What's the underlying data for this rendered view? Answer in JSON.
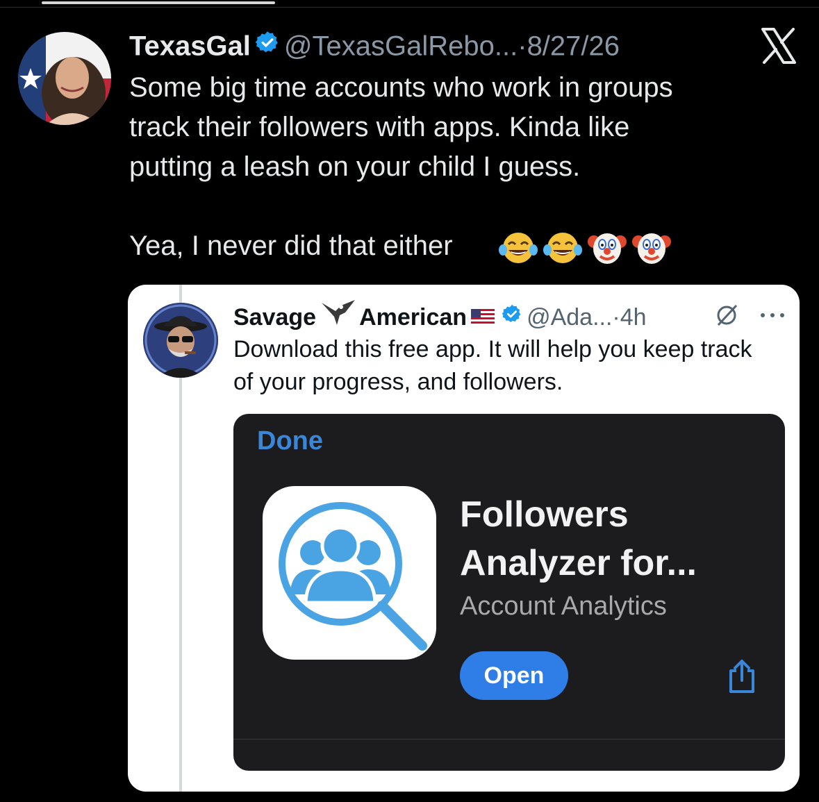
{
  "post": {
    "author_name": "TexasGal",
    "handle": "@TexasGalRebo...",
    "separator": "·",
    "date": "8/27/26",
    "text": "Some big time accounts who work in groups\ntrack their followers with apps. Kinda like\nputting a leash on your child I guess.\n\nYea, I never did that either",
    "emojis": [
      "face-with-tears-of-joy",
      "face-with-tears-of-joy",
      "clown-face",
      "clown-face"
    ]
  },
  "quoted": {
    "author_first": "Savage",
    "author_last": "American",
    "handle": "@Ada...",
    "separator": "·",
    "time": "4h",
    "text": "Download this free app. It will help you keep track of your progress, and followers."
  },
  "app_sheet": {
    "done_label": "Done",
    "app_title": "Followers Analyzer for...",
    "app_subtitle": "Account Analytics",
    "open_label": "Open"
  },
  "colors": {
    "background": "#000000",
    "verified_blue": "#1d9bf0",
    "link_blue": "#3a86d8",
    "open_button": "#2f7ee8",
    "app_icon_blue": "#4aa3e3"
  }
}
